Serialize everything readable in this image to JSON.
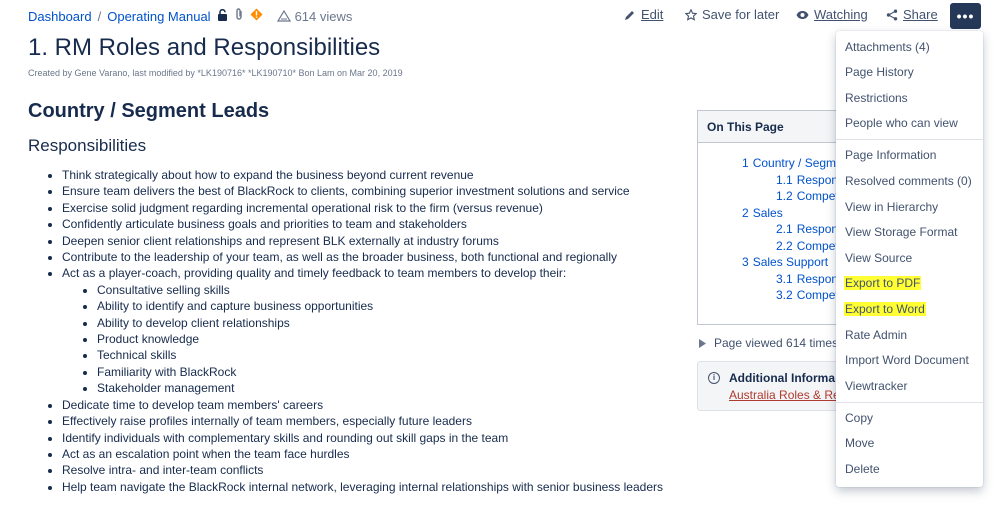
{
  "breadcrumb": {
    "items": [
      "Dashboard",
      "Operating Manual"
    ],
    "separator": "/"
  },
  "views": {
    "label": "614 views"
  },
  "actions": {
    "edit": "Edit",
    "save_for_later": "Save for later",
    "watching": "Watching",
    "share": "Share",
    "more": "•••"
  },
  "page": {
    "title": "1. RM Roles and Responsibilities",
    "byline": "Created by Gene Varano, last modified by *LK190716* *LK190710* Bon Lam on Mar 20, 2019",
    "section_heading": "Country / Segment Leads",
    "sub_heading": "Responsibilities"
  },
  "bullets": [
    "Think strategically about how to expand the business beyond current revenue",
    "Ensure team delivers the best of BlackRock to clients, combining superior investment solutions and service",
    "Exercise solid judgment regarding incremental operational risk to the firm (versus revenue)",
    "Confidently articulate business goals and priorities to team and stakeholders",
    "Deepen senior client relationships and represent BLK externally at industry forums",
    "Contribute to the leadership of your team, as well as the broader business, both functional and regionally",
    "Act as a player-coach, providing quality and timely feedback to team members to develop their:"
  ],
  "sub_bullets": [
    "Consultative selling skills",
    "Ability to identify and capture business opportunities",
    "Ability to develop client relationships",
    "Product knowledge",
    "Technical skills",
    "Familiarity with BlackRock",
    "Stakeholder management"
  ],
  "bullets_after": [
    "Dedicate time to develop team members' careers",
    "Effectively raise profiles internally of team members, especially future leaders",
    "Identify individuals with complementary skills and rounding out skill gaps in the team",
    "Act as an escalation point when the team face hurdles",
    "Resolve intra- and inter-team conflicts",
    "Help team navigate the BlackRock internal network, leveraging internal relationships with senior business leaders"
  ],
  "toc": {
    "heading": "On This Page",
    "entries": [
      {
        "num": "1",
        "text": "Country / Segm"
      },
      {
        "num": "1.1",
        "text": "Respon"
      },
      {
        "num": "1.2",
        "text": "Compet"
      },
      {
        "num": "2",
        "text": "Sales"
      },
      {
        "num": "2.1",
        "text": "Respon"
      },
      {
        "num": "2.2",
        "text": "Compet"
      },
      {
        "num": "3",
        "text": "Sales Support"
      },
      {
        "num": "3.1",
        "text": "Respon"
      },
      {
        "num": "3.2",
        "text": "Compet"
      }
    ]
  },
  "page_viewed": "Page viewed 614 times",
  "additional": {
    "title": "Additional Informa",
    "link": "Australia Roles & Re"
  },
  "menu": {
    "group1": [
      "Attachments (4)",
      "Page History",
      "Restrictions",
      "People who can view"
    ],
    "group2": [
      "Page Information",
      "Resolved comments (0)",
      "View in Hierarchy",
      "View Storage Format",
      "View Source",
      "Export to PDF",
      "Export to Word",
      "Rate Admin",
      "Import Word Document",
      "Viewtracker"
    ],
    "group3": [
      "Copy",
      "Move",
      "Delete"
    ]
  },
  "colors": {
    "link": "#0052cc",
    "highlight": "#ffff33",
    "more_button": "#253858",
    "text": "#172b4d"
  },
  "icons": [
    "unlocked-icon",
    "attachment-icon",
    "diamond-warning-icon",
    "eye-icon",
    "pencil-icon",
    "star-icon",
    "share-icon",
    "info-icon",
    "triangle-right-icon"
  ]
}
